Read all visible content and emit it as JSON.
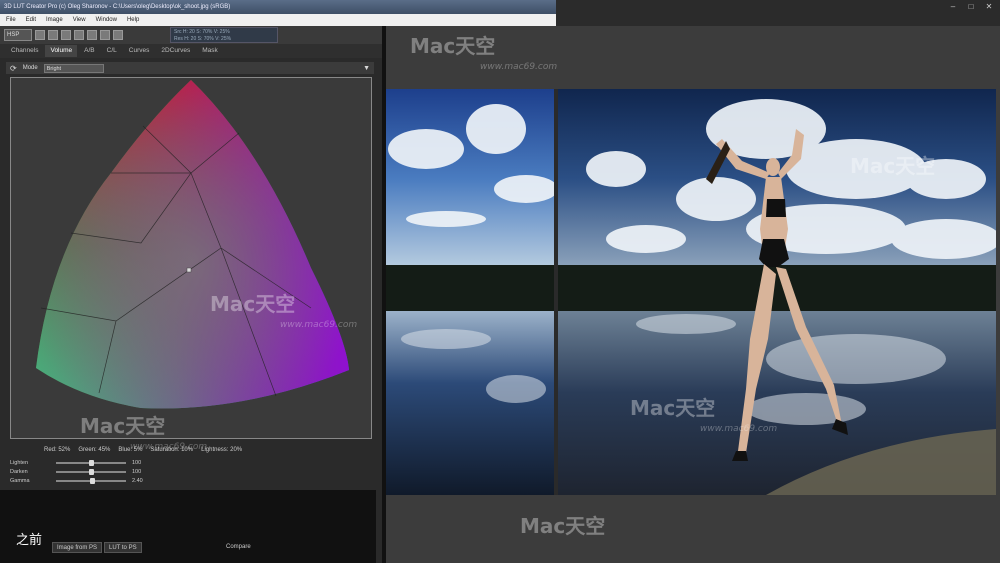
{
  "window": {
    "title": "3D LUT Creator Pro (c) Oleg Sharonov - C:\\Users\\oleg\\Desktop\\ok_shoot.jpg (sRGB)"
  },
  "menu": [
    "File",
    "Edit",
    "Image",
    "View",
    "Window",
    "Help"
  ],
  "toolbar": {
    "colorspace": "HSP",
    "readout_line1": "Src H: 20  S: 70%  V: 25%",
    "readout_line2": "Res H: 20  S: 70%  V: 25%"
  },
  "tabs": [
    "Channels",
    "Volume",
    "A/B",
    "C/L",
    "Curves",
    "2DCurves",
    "Mask"
  ],
  "active_tab": "Volume",
  "mode": {
    "label": "Mode",
    "value": "Bright"
  },
  "readings": {
    "red": "Red: 52%",
    "green": "Green: 45%",
    "blue": "Blue: 5%",
    "saturation": "Saturation: 10%",
    "lightness": "Lightness: 20%"
  },
  "sliders": [
    {
      "label": "Lighten",
      "value": "100",
      "level": 0.5
    },
    {
      "label": "Darken",
      "value": "100",
      "level": 0.5
    },
    {
      "label": "Gamma",
      "value": "2.40",
      "level": 0.52
    }
  ],
  "bottom": {
    "image_from_ps": "Image from PS",
    "lut_to_ps": "LUT to PS",
    "compare": "Compare"
  },
  "overlay": {
    "before": "之前"
  },
  "watermark": {
    "brand": "Mac天空",
    "url": "www.mac69.com"
  },
  "window_controls": [
    "minimize-icon",
    "maximize-icon",
    "close-icon"
  ]
}
